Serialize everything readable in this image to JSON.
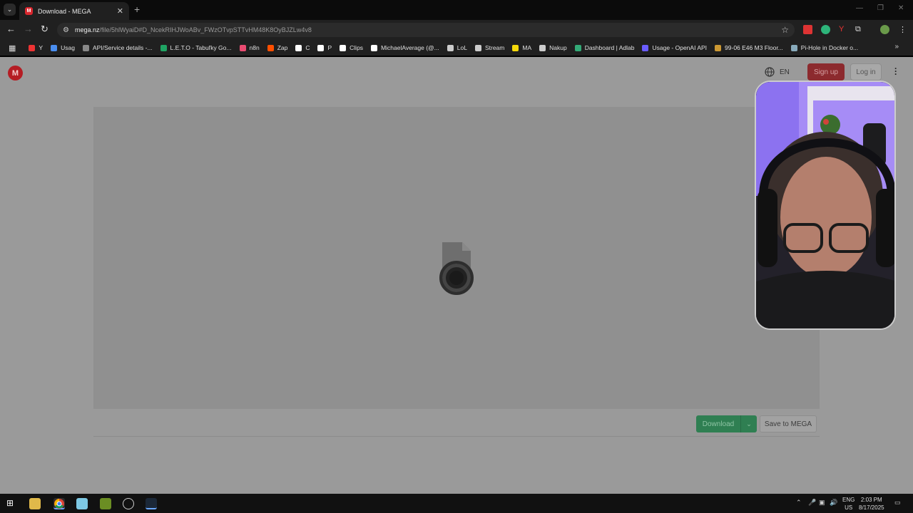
{
  "browser": {
    "tab_title": "Download - MEGA",
    "tab_favicon": "M",
    "new_tab": "+",
    "url_host": "mega.nz",
    "url_path": "/file/5hlWyaiD#D_NcekRIHJWoABv_FWzOTvpSTTvHM48K8OyBJZLw4v8",
    "bookmarks": [
      {
        "label": "Y",
        "icon_color": "#e33"
      },
      {
        "label": "Usag",
        "icon_color": "#4a8ef0"
      },
      {
        "label": "API/Service details -...",
        "icon_color": "#888"
      },
      {
        "label": "L.E.T.O - Tabuľky Go...",
        "icon_color": "#1fa463"
      },
      {
        "label": "n8n",
        "icon_color": "#ea4b71"
      },
      {
        "label": "Zap",
        "icon_color": "#ff4f00"
      },
      {
        "label": "C",
        "icon_color": "#fff"
      },
      {
        "label": "P",
        "icon_color": "#fff"
      },
      {
        "label": "Clips",
        "icon_color": "#fff"
      },
      {
        "label": "MichaelAverage (@...",
        "icon_color": "#fff"
      },
      {
        "label": "LoL",
        "icon_color": "#ccc"
      },
      {
        "label": "Stream",
        "icon_color": "#ccc"
      },
      {
        "label": "MA",
        "icon_color": "#f5d90a"
      },
      {
        "label": "Nakup",
        "icon_color": "#ccc"
      },
      {
        "label": "Dashboard | Adlab",
        "icon_color": "#3a7"
      },
      {
        "label": "Usage - OpenAI API",
        "icon_color": "#6a5cff"
      },
      {
        "label": "99-06 E46 M3 Floor...",
        "icon_color": "#c93"
      },
      {
        "label": "Pi-Hole in Docker o...",
        "icon_color": "#8ab"
      }
    ],
    "bookmarks_more": "»"
  },
  "mega": {
    "logo": "M",
    "language": "EN",
    "signup_label": "Sign up",
    "login_label": "Log in",
    "download_label": "Download",
    "save_label": "Save to MEGA"
  },
  "taskbar": {
    "lang_top": "ENG",
    "lang_bottom": "US",
    "time": "2:03 PM",
    "date": "8/17/2025"
  }
}
